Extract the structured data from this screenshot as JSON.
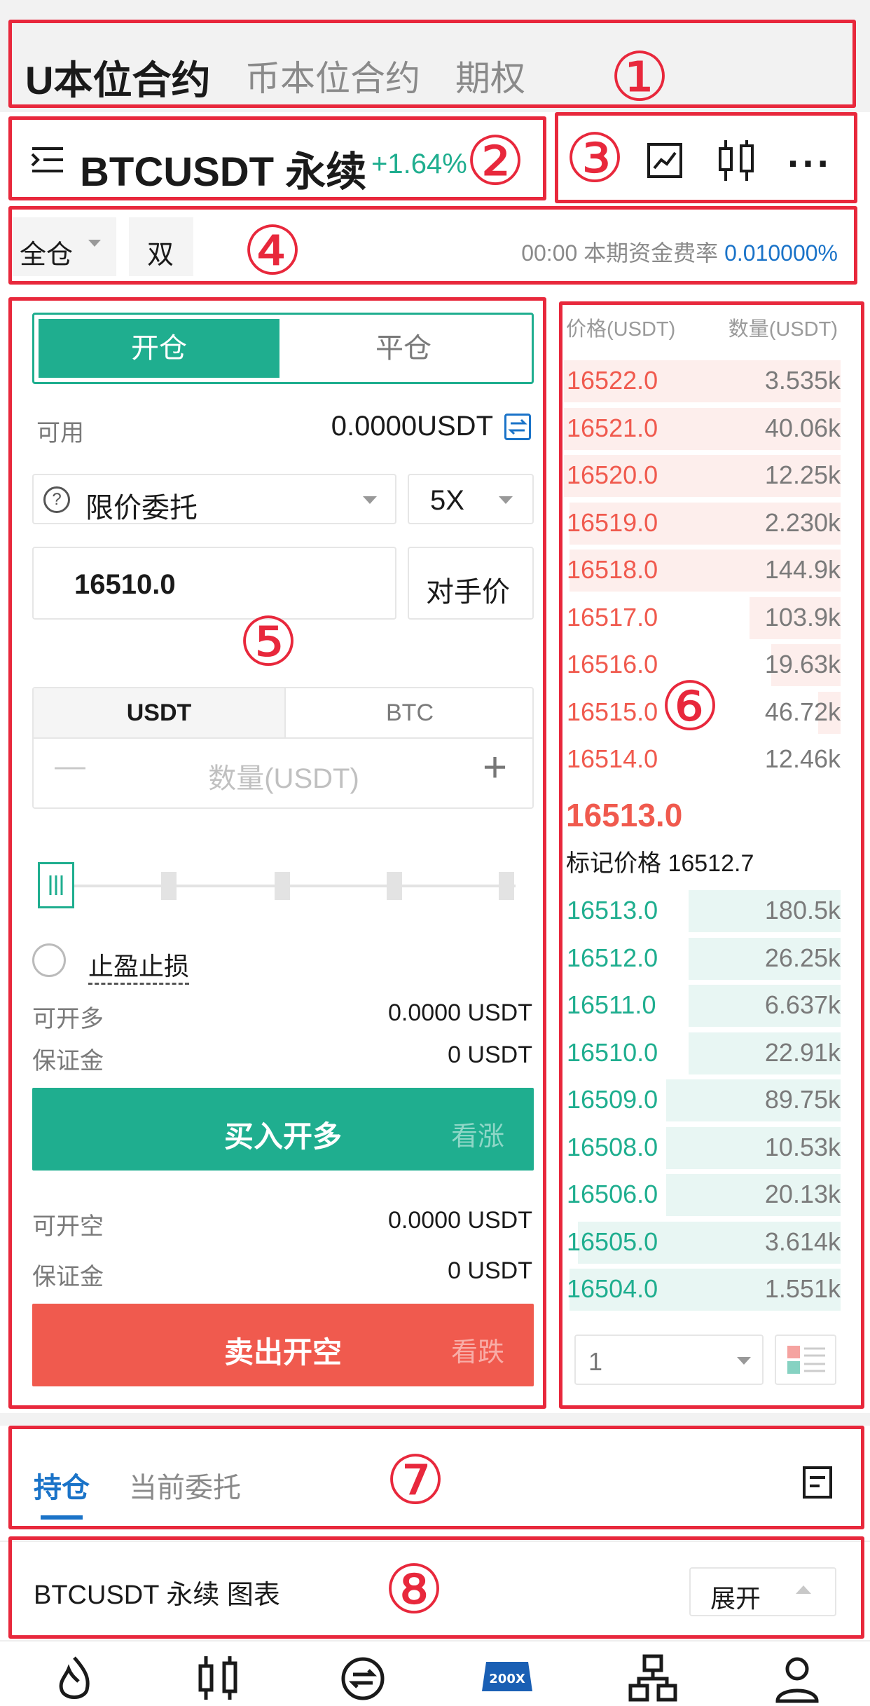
{
  "top_tabs": [
    {
      "label": "U本位合约"
    },
    {
      "label": "币本位合约"
    },
    {
      "label": "期权"
    }
  ],
  "symbol": {
    "name": "BTCUSDT 永续",
    "change": "+1.64%",
    "change_color": "#1fae8f"
  },
  "margin": {
    "mode": "全仓",
    "position_mode": "双",
    "funding_time": "00:00",
    "funding_label": "本期资金费率",
    "funding_rate": "0.010000%"
  },
  "order": {
    "side_tabs": {
      "open": "开仓",
      "close": "平仓"
    },
    "available_label": "可用",
    "available_value": "0.0000USDT",
    "order_type": "限价委托",
    "leverage": "5X",
    "price": "16510.0",
    "counter_price_label": "对手价",
    "unit_tabs": {
      "usdt": "USDT",
      "btc": "BTC"
    },
    "qty_placeholder": "数量(USDT)",
    "qty_minus": "—",
    "qty_plus": "+",
    "slider_percent": 0,
    "tpsl_label": "止盈止损",
    "long": {
      "max_label": "可开多",
      "max_value": "0.0000 USDT",
      "margin_label": "保证金",
      "margin_value": "0 USDT",
      "button": "买入开多",
      "hint": "看涨"
    },
    "short": {
      "max_label": "可开空",
      "max_value": "0.0000 USDT",
      "margin_label": "保证金",
      "margin_value": "0 USDT",
      "button": "卖出开空",
      "hint": "看跌"
    }
  },
  "orderbook": {
    "header_price": "价格(USDT)",
    "header_qty": "数量(USDT)",
    "asks": [
      {
        "price": "16522.0",
        "qty": "3.535k",
        "depth": 1.0
      },
      {
        "price": "16521.0",
        "qty": "40.06k",
        "depth": 1.0
      },
      {
        "price": "16520.0",
        "qty": "12.25k",
        "depth": 1.0
      },
      {
        "price": "16519.0",
        "qty": "2.230k",
        "depth": 0.98
      },
      {
        "price": "16518.0",
        "qty": "144.9k",
        "depth": 0.98
      },
      {
        "price": "16517.0",
        "qty": "103.9k",
        "depth": 0.33
      },
      {
        "price": "16516.0",
        "qty": "19.63k",
        "depth": 0.25
      },
      {
        "price": "16515.0",
        "qty": "46.72k",
        "depth": 0.08
      },
      {
        "price": "16514.0",
        "qty": "12.46k",
        "depth": 0.0
      }
    ],
    "last_price": "16513.0",
    "mark_price_label": "标记价格",
    "mark_price": "16512.7",
    "bids": [
      {
        "price": "16513.0",
        "qty": "180.5k",
        "depth": 0.55
      },
      {
        "price": "16512.0",
        "qty": "26.25k",
        "depth": 0.55
      },
      {
        "price": "16511.0",
        "qty": "6.637k",
        "depth": 0.55
      },
      {
        "price": "16510.0",
        "qty": "22.91k",
        "depth": 0.55
      },
      {
        "price": "16509.0",
        "qty": "89.75k",
        "depth": 0.63
      },
      {
        "price": "16508.0",
        "qty": "10.53k",
        "depth": 0.63
      },
      {
        "price": "16506.0",
        "qty": "20.13k",
        "depth": 0.63
      },
      {
        "price": "16505.0",
        "qty": "3.614k",
        "depth": 0.95
      },
      {
        "price": "16504.0",
        "qty": "1.551k",
        "depth": 0.98
      }
    ],
    "precision": "1"
  },
  "bottom_tabs": [
    {
      "label": "持仓"
    },
    {
      "label": "当前委托"
    }
  ],
  "chart_bar": {
    "title": "BTCUSDT 永续 图表",
    "expand_label": "展开"
  },
  "annotations": [
    "①",
    "②",
    "③",
    "④",
    "⑤",
    "⑥",
    "⑦",
    "⑧"
  ],
  "colors": {
    "green": "#1fae8f",
    "red": "#f05a4e",
    "blue": "#1a73c8",
    "annot": "#e8283c"
  },
  "nav_icons": [
    "flame-icon",
    "candlestick-icon",
    "exchange-icon",
    "200x-icon",
    "hierarchy-icon",
    "profile-icon"
  ],
  "nav_200x_label": "200X"
}
